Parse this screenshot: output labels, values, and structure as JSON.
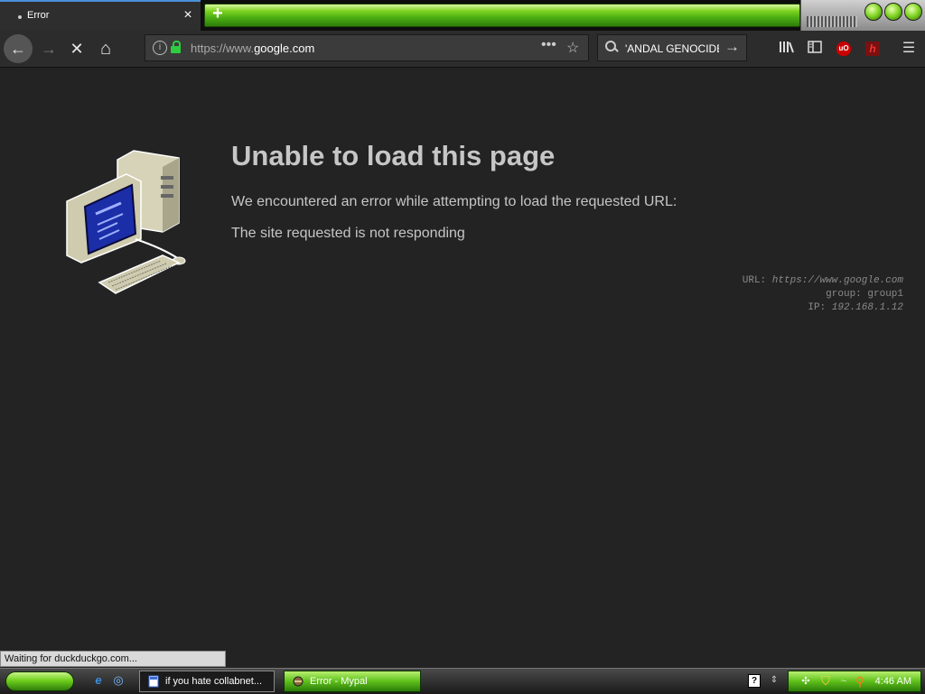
{
  "tab": {
    "title": "Error",
    "close": "×",
    "new_tab": "+"
  },
  "nav": {
    "back": "←",
    "forward": "→",
    "stop": "✕",
    "home": "⌂",
    "url_prefix": "https://www.",
    "url_domain": "google.com",
    "page_actions": "•••",
    "bookmark": "☆",
    "search_text": "'ANDAL GENOCIDE",
    "search_go": "→",
    "menu": "☰"
  },
  "toolbar_icons": [
    "library-icon",
    "sidebar-icon",
    "ublock-icon",
    "h-extension-icon"
  ],
  "error": {
    "title": "Unable to load this page",
    "line1": "We encountered an error while attempting to load the requested URL:",
    "line2": "The site requested is not responding"
  },
  "meta": {
    "url_label": "URL:",
    "url_value": "https://www.google.com",
    "group_label": "group:",
    "group_value": "group1",
    "ip_label": "IP:",
    "ip_value": "192.168.1.12"
  },
  "status_text": "Waiting for duckduckgo.com...",
  "taskbar": {
    "task1": "if you hate collabnet...",
    "task2": "Error - Mypal",
    "help": "?",
    "clock": "4:46 AM"
  },
  "colors": {
    "accent_green": "#5ec01a",
    "content_bg": "#232323",
    "text": "#c6c6c6"
  }
}
